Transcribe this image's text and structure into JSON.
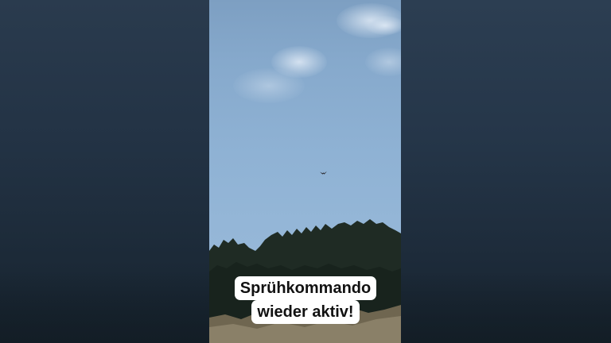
{
  "caption": {
    "line1": "Sprühkommando",
    "line2": "wieder aktiv!"
  },
  "scene": {
    "subject": "bird-in-sky-icon",
    "sky_color": "#8fb2d4",
    "tree_color": "#1d2a22",
    "side_panel_color": "#25364a"
  }
}
